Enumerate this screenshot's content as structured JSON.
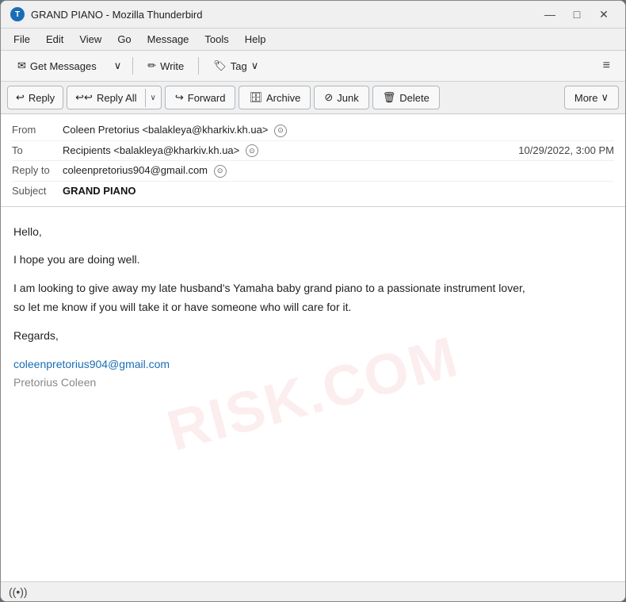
{
  "window": {
    "title": "GRAND PIANO - Mozilla Thunderbird",
    "icon": "T"
  },
  "title_controls": {
    "minimize": "—",
    "maximize": "□",
    "close": "✕"
  },
  "menu": {
    "items": [
      "File",
      "Edit",
      "View",
      "Go",
      "Message",
      "Tools",
      "Help"
    ]
  },
  "toolbar": {
    "get_messages_label": "Get Messages",
    "write_label": "Write",
    "tag_label": "Tag",
    "hamburger": "≡",
    "dropdown_arrow": "∨"
  },
  "actions": {
    "reply_label": "Reply",
    "reply_all_label": "Reply All",
    "forward_label": "Forward",
    "archive_label": "Archive",
    "junk_label": "Junk",
    "delete_label": "Delete",
    "more_label": "More",
    "dropdown_arrow": "∨"
  },
  "email": {
    "from_label": "From",
    "from_name": "Coleen Pretorius",
    "from_email": "<balakleya@kharkiv.kh.ua>",
    "to_label": "To",
    "to_value": "Recipients <balakleya@kharkiv.kh.ua>",
    "date": "10/29/2022, 3:00 PM",
    "reply_to_label": "Reply to",
    "reply_to_email": "coleenpretorius904@gmail.com",
    "subject_label": "Subject",
    "subject_value": "GRAND PIANO",
    "body_greeting": "Hello,",
    "body_line1": "I hope you are doing well.",
    "body_line2": "I am looking to give away my late husband's Yamaha baby grand piano to a passionate instrument lover,",
    "body_line3": " so let me know if you will take it or have someone who will care for it.",
    "regards": "Regards,",
    "signature_email": "coleenpretorius904@gmail.com",
    "signature_name": "Pretorius Coleen"
  },
  "status": {
    "icon": "((•))"
  },
  "icons": {
    "reply": "↩",
    "reply_all": "↩↩",
    "forward": "↪",
    "archive": "🗄",
    "junk": "⊘",
    "delete": "🗑",
    "get_messages": "✉",
    "write": "✏",
    "tag": "🏷",
    "person": "⊙",
    "chevron_down": "∨"
  },
  "watermark": "RISK.COM"
}
